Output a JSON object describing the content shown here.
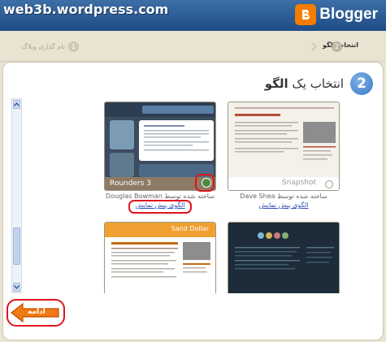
{
  "watermark": "web3b.wordpress.com",
  "logo": {
    "text": "Blogger"
  },
  "steps": [
    {
      "num": "1",
      "label": "نام گذاری وبلاگ"
    },
    {
      "num": "2",
      "label": "انتخاب الگو"
    }
  ],
  "panel": {
    "step_number": "2",
    "title_prefix": "انتخاب یک",
    "title_bold": "الگو"
  },
  "templates": [
    {
      "title": "Rounders 3",
      "author": "ساخته شده توسط Douglas Bowman",
      "preview": "الگوی پیش نمایش"
    },
    {
      "title": "Snapshot",
      "author": "ساخته شده توسط Dave Shea",
      "preview": "الگوی پیش نمایش"
    },
    {
      "title": "Sand Dollar",
      "author": "",
      "preview": ""
    },
    {
      "title": "",
      "author": "",
      "preview": ""
    }
  ],
  "continue_label": "ادامه",
  "colors": {
    "header": "#2b5b95",
    "blogger_orange": "#f57d00",
    "highlight_red": "#e0141e",
    "link_blue": "#3354b8",
    "step_blue": "#3b78c4"
  }
}
